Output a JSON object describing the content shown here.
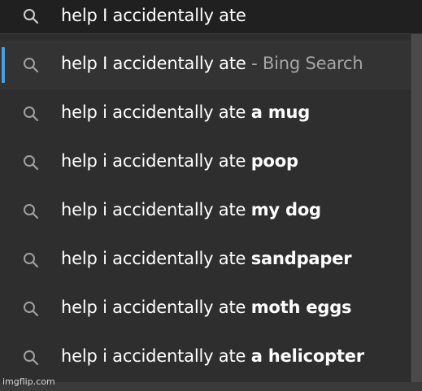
{
  "search": {
    "query": "help I accidentally ate",
    "icon": "search-icon"
  },
  "suggestions": [
    {
      "prefix": "help I accidentally ate",
      "suffix": "",
      "muted": " - Bing Search",
      "selected": true
    },
    {
      "prefix": "help i accidentally ate ",
      "suffix": "a mug",
      "muted": "",
      "selected": false
    },
    {
      "prefix": "help i accidentally ate ",
      "suffix": "poop",
      "muted": "",
      "selected": false
    },
    {
      "prefix": "help i accidentally ate ",
      "suffix": "my dog",
      "muted": "",
      "selected": false
    },
    {
      "prefix": "help i accidentally ate ",
      "suffix": "sandpaper",
      "muted": "",
      "selected": false
    },
    {
      "prefix": "help i accidentally ate ",
      "suffix": "moth eggs",
      "muted": "",
      "selected": false
    },
    {
      "prefix": "help i accidentally ate ",
      "suffix": "a helicopter",
      "muted": "",
      "selected": false
    }
  ],
  "watermark": "imgflip.com",
  "colors": {
    "accent": "#4a9fe0",
    "background": "#2e2e2e",
    "muted_text": "#a6a6a6"
  }
}
